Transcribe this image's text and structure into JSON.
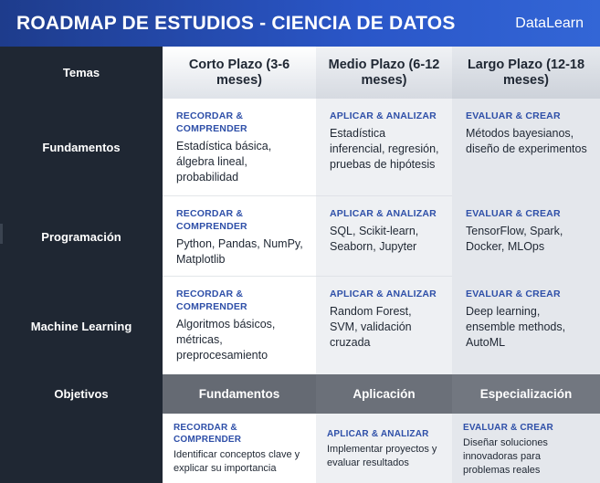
{
  "header": {
    "title": "ROADMAP DE ESTUDIOS - CIENCIA DE DATOS",
    "brand": "DataLearn"
  },
  "sidebar": {
    "temas": "Temas",
    "rows": [
      "Fundamentos",
      "Programación",
      "Machine Learning"
    ],
    "objetivos": "Objetivos"
  },
  "columns": [
    {
      "title": "Corto Plazo (3-6 meses)",
      "tag": "RECORDAR & COMPRENDER"
    },
    {
      "title": "Medio Plazo (6-12 meses)",
      "tag": "APLICAR & ANALIZAR"
    },
    {
      "title": "Largo Plazo (12-18 meses)",
      "tag": "EVALUAR & CREAR"
    }
  ],
  "grid": [
    [
      "Estadística básica, álgebra lineal, probabilidad",
      "Estadística inferencial, regresión, pruebas de hipótesis",
      "Métodos bayesianos, diseño de experimentos"
    ],
    [
      "Python, Pandas, NumPy, Matplotlib",
      "SQL, Scikit-learn, Seaborn, Jupyter",
      "TensorFlow, Spark, Docker, MLOps"
    ],
    [
      "Algoritmos básicos, métricas, preprocesamiento",
      "Random Forest, SVM, validación cruzada",
      "Deep learning, ensemble methods, AutoML"
    ]
  ],
  "objectives": {
    "labels": [
      "Fundamentos",
      "Aplicación",
      "Especialización"
    ],
    "texts": [
      "Identificar conceptos clave y explicar su importancia",
      "Implementar proyectos y evaluar resultados",
      "Diseñar soluciones innovadoras para problemas reales"
    ]
  }
}
